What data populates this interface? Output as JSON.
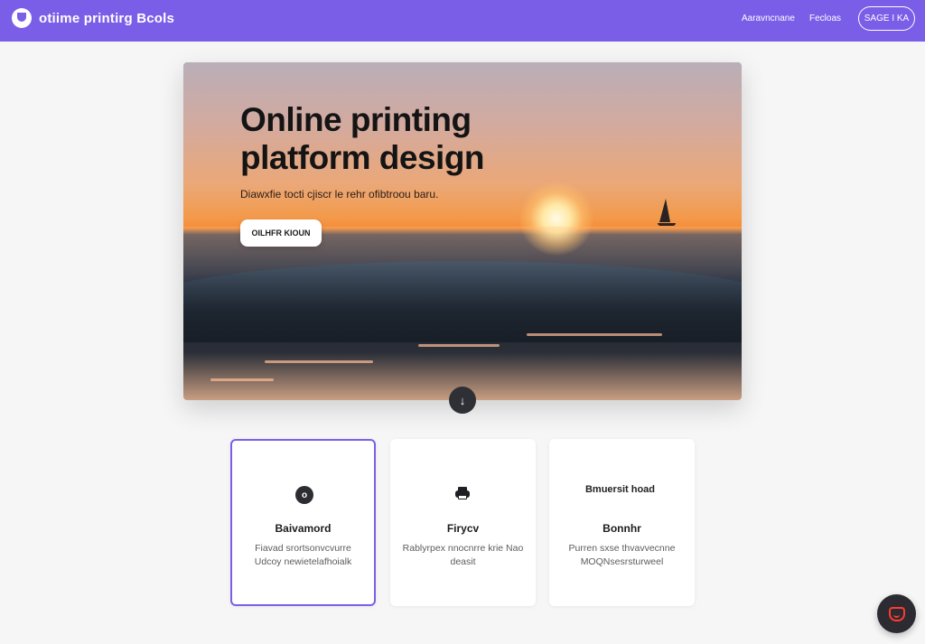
{
  "header": {
    "brand": "otiime printirg Bcols",
    "nav": [
      "Aaravncnane",
      "Fecloas"
    ],
    "cta": "SAGE I KA"
  },
  "hero": {
    "title": "Online printing platform design",
    "subtitle": "Diawxfie tocti cjiscr le rehr ofibtroou baru.",
    "cta": "OILHFR KIOUN",
    "scroll_icon": "arrow-down-icon"
  },
  "cards": [
    {
      "icon": "ring-icon",
      "icon_glyph": "o",
      "title": "Baivamord",
      "desc": "Fiavad srortsonvcvurre Udcoy newietelafhoialk",
      "selected": true
    },
    {
      "icon": "printer-icon",
      "title": "Firycv",
      "desc": "Rablyrpex nnocnrre krie Nao deasit",
      "selected": false
    },
    {
      "badge": "Bmuersit hoad",
      "title": "Bonnhr",
      "desc": "Purren sxse thvavvecnne MOQNsesrsturweel",
      "selected": false
    }
  ],
  "chat": {
    "icon": "chat-icon"
  },
  "colors": {
    "brand": "#7a5ee8",
    "card_selected_border": "#7b5fe6",
    "chat_accent": "#ff3b30"
  }
}
